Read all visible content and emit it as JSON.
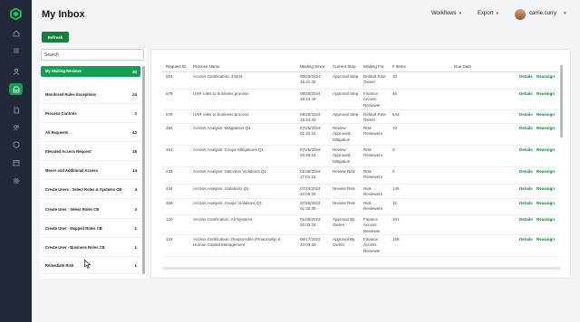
{
  "header": {
    "title": "My Inbox",
    "workflows_label": "Workflows",
    "export_label": "Export",
    "user_name": "carrie.curry"
  },
  "toolbar": {
    "refresh_label": "Refresh"
  },
  "search": {
    "placeholder": "Search"
  },
  "inbox_list": [
    {
      "label": "My Waiting Reviews",
      "count": "30",
      "active": true
    },
    {
      "label": "Monitored Rules Exceptions",
      "count": "24"
    },
    {
      "label": "Process Controls",
      "count": "2"
    },
    {
      "label": "All Requests",
      "count": "43"
    },
    {
      "label": "Elevated Access Request",
      "count": "18"
    },
    {
      "label": "Mover and Additional Access",
      "count": "14"
    },
    {
      "label": "Create Users - Select Roles & Systems CB",
      "count": "4"
    },
    {
      "label": "Create User - Select Roles CB",
      "count": "3"
    },
    {
      "label": "Create User - Mapped Roles CB",
      "count": "1"
    },
    {
      "label": "Create User - Business Roles CB",
      "count": "1"
    },
    {
      "label": "Remediate Risk",
      "count": "1"
    }
  ],
  "table": {
    "columns": [
      "Request ID",
      "Process Name",
      "Waiting Since",
      "Current Step",
      "Waiting For",
      "# Items",
      "Due Date"
    ],
    "details_label": "Details",
    "reassign_label": "Reassign",
    "rows": [
      {
        "id": "504",
        "process": "Access Certification: 44444",
        "since": "08/23/2024 16:41:45",
        "step": "Approval Step",
        "waiting_for": "Default Role Owner",
        "items": "10",
        "due": ""
      },
      {
        "id": "578",
        "process": "UAR roles to business process",
        "since": "08/20/2024 15:44:44",
        "step": "Approval Step",
        "waiting_for": "Finance Access Reviewer",
        "items": "45",
        "due": ""
      },
      {
        "id": "578",
        "process": "UAR roles to business process",
        "since": "08/20/2024 15:44:44",
        "step": "Approval Step",
        "waiting_for": "Default Role Owner",
        "items": "543",
        "due": ""
      },
      {
        "id": "455",
        "process": "Access Analysis: Mitigations Q1",
        "since": "07/25/2024 01:42:15",
        "step": "Review Approved Mitigation",
        "waiting_for": "Risk Reviewers",
        "items": "10",
        "due": ""
      },
      {
        "id": "461",
        "process": "Access Analysis: Conjur Mitigations Q1",
        "since": "07/25/2024 20:28:15",
        "step": "Review Approved Mitigation",
        "waiting_for": "Risk Reviewers",
        "items": "3",
        "due": ""
      },
      {
        "id": "233",
        "process": "Access Analysis: Selective Violations Q1",
        "since": "01/30/2024 17:01:22",
        "step": "Review Risk",
        "waiting_for": "Risk Reviewers",
        "items": "0",
        "due": ""
      },
      {
        "id": "434",
        "process": "Access Analysis: Violations Q1",
        "since": "07/24/2024 22:05:25",
        "step": "Review Risk",
        "waiting_for": "Risk Reviewers",
        "items": "146",
        "due": ""
      },
      {
        "id": "456",
        "process": "Access Analysis: Conjur Violations Q1",
        "since": "07/25/2024 01:32:39",
        "step": "Review Risk",
        "waiting_for": "Risk Reviewers",
        "items": "12",
        "due": ""
      },
      {
        "id": "120",
        "process": "Access Certification: All Systems",
        "since": "01/08/2023 20:03:24",
        "step": "Approval By Owner",
        "waiting_for": "Finance Access Reviewer",
        "items": "101",
        "due": ""
      },
      {
        "id": "142",
        "process": "Access Certification: Responsible (Financially) & Human Capital Management",
        "since": "08/17/2023 20:03:32",
        "step": "Approval By Owner",
        "waiting_for": "Finance Access Reviewer",
        "items": "169",
        "due": ""
      }
    ]
  },
  "colors": {
    "accent": "#15803d",
    "active_item": "#1a9a55",
    "rail": "#1f2937"
  },
  "rail_icons": [
    "logo-icon",
    "home-icon",
    "list-icon",
    "user-icon",
    "inbox-icon",
    "document-icon",
    "people-icon",
    "shield-icon",
    "calendar-icon",
    "settings-icon"
  ]
}
